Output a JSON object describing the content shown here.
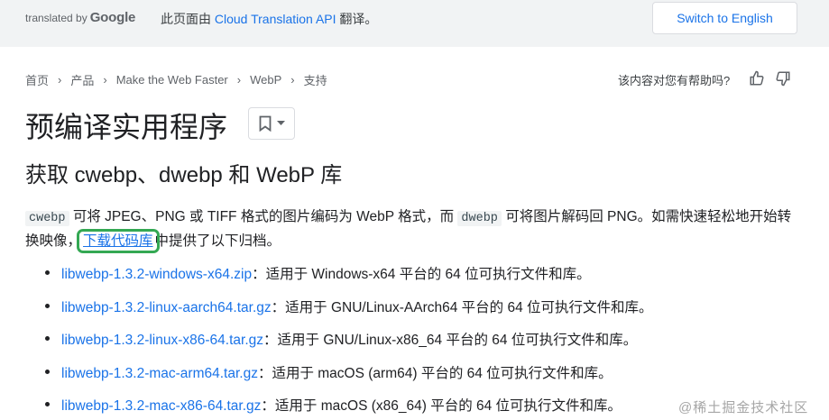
{
  "topbar": {
    "translated_by": "translated by",
    "google": "Google",
    "note_prefix": "此页面由 ",
    "note_link": "Cloud Translation API",
    "note_suffix": " 翻译。",
    "switch_label": "Switch to English"
  },
  "breadcrumb": [
    "首页",
    "产品",
    "Make the Web Faster",
    "WebP",
    "支持"
  ],
  "feedback": {
    "question": "该内容对您有帮助吗?",
    "up_icon": "thumb-up-icon",
    "down_icon": "thumb-down-icon"
  },
  "page": {
    "title": "预编译实用程序",
    "subtitle": "获取 cwebp、dwebp 和 WebP 库"
  },
  "intro": {
    "code1": "cwebp",
    "text1": " 可将 JPEG、PNG 或 TIFF 格式的图片编码为 WebP 格式，而 ",
    "code2": "dwebp",
    "text2": " 可将图片解码回 PNG。如需快速轻松地开始转换映像，",
    "link": "下载代码库",
    "text3": "中提供了以下归档。",
    "highlight_color": "#34a853"
  },
  "downloads": [
    {
      "file": "libwebp-1.3.2-windows-x64.zip",
      "desc": "：适用于 Windows-x64 平台的 64 位可执行文件和库。"
    },
    {
      "file": "libwebp-1.3.2-linux-aarch64.tar.gz",
      "desc": "：适用于 GNU/Linux-AArch64 平台的 64 位可执行文件和库。"
    },
    {
      "file": "libwebp-1.3.2-linux-x86-64.tar.gz",
      "desc": "：适用于 GNU/Linux-x86_64 平台的 64 位可执行文件和库。"
    },
    {
      "file": "libwebp-1.3.2-mac-arm64.tar.gz",
      "desc": "：适用于 macOS (arm64) 平台的 64 位可执行文件和库。"
    },
    {
      "file": "libwebp-1.3.2-mac-x86-64.tar.gz",
      "desc": "：适用于 macOS (x86_64) 平台的 64 位可执行文件和库。"
    }
  ],
  "watermark": "@稀土掘金技术社区",
  "colors": {
    "link": "#1a73e8",
    "topbar_bg": "#f1f3f4",
    "text": "#202124"
  }
}
